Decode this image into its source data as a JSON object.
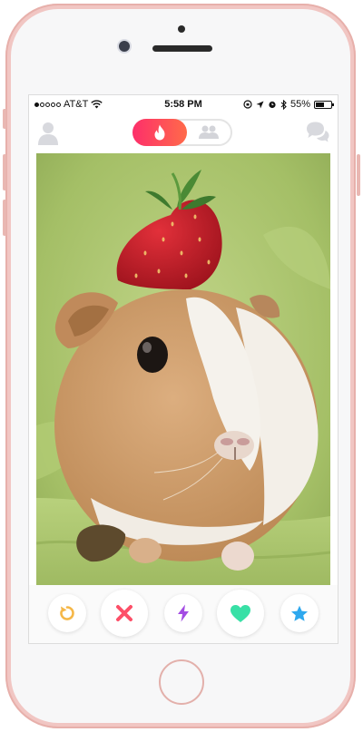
{
  "device": {
    "frame_color": "#f1c6c3",
    "icons": {
      "front_camera": "camera-lens",
      "earpiece": "speaker-grille",
      "home_button": "home-button"
    }
  },
  "status_bar": {
    "carrier": "AT&T",
    "time": "5:58 PM",
    "battery": "55%",
    "battery_level": 0.55,
    "signal_bars_filled": 1,
    "signal_bars_total": 5,
    "icons": [
      "wifi-icon",
      "rotation-lock-icon",
      "location-icon",
      "alarm-icon",
      "bluetooth-icon",
      "battery-icon"
    ]
  },
  "top_nav": {
    "profile_icon": "person-icon",
    "toggle": {
      "options": [
        "flame-icon",
        "group-icon"
      ],
      "active": "flame-icon",
      "active_gradient": [
        "#fd2f6a",
        "#ff6a4a"
      ]
    },
    "messages_icon": "chat-bubbles-icon"
  },
  "card": {
    "photo": "guinea pig with a strawberry on its head"
  },
  "actions": [
    {
      "name": "rewind",
      "icon": "rewind-icon",
      "color": "#f5b748"
    },
    {
      "name": "nope",
      "icon": "x-icon",
      "color": "#fd4f68"
    },
    {
      "name": "boost",
      "icon": "lightning-icon",
      "color": "#a34ce3"
    },
    {
      "name": "like",
      "icon": "heart-icon",
      "color": "#38e0a6"
    },
    {
      "name": "super-like",
      "icon": "star-icon",
      "color": "#2ea8ee"
    }
  ]
}
